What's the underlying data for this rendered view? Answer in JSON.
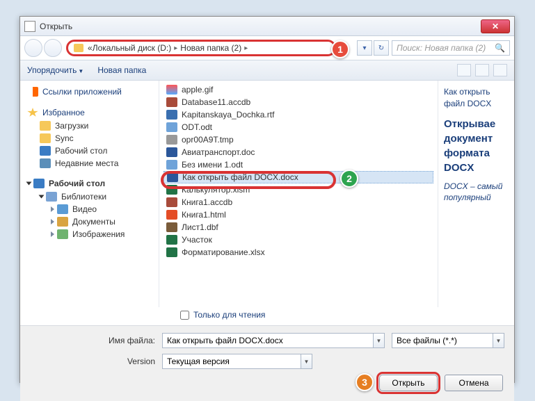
{
  "window": {
    "title": "Открыть"
  },
  "breadcrumb": {
    "prefix": "«",
    "segments": [
      "Локальный диск (D:)",
      "Новая папка (2)"
    ]
  },
  "search": {
    "placeholder": "Поиск: Новая папка (2)"
  },
  "toolbar": {
    "organize": "Упорядочить",
    "newfolder": "Новая папка"
  },
  "sidebar": {
    "appLinks": "Ссылки приложений",
    "favorites": "Избранное",
    "favItems": [
      "Загрузки",
      "Sync",
      "Рабочий стол",
      "Недавние места"
    ],
    "desktop": "Рабочий стол",
    "libraries": "Библиотеки",
    "libItems": [
      "Видео",
      "Документы",
      "Изображения"
    ]
  },
  "files": [
    {
      "name": "apple.gif",
      "ext": "gif"
    },
    {
      "name": "Database11.accdb",
      "ext": "accdb"
    },
    {
      "name": "Kapitanskaya_Dochka.rtf",
      "ext": "rtf"
    },
    {
      "name": "ODT.odt",
      "ext": "odt"
    },
    {
      "name": "opr00A9T.tmp",
      "ext": "tmp"
    },
    {
      "name": "Авиатранспорт.doc",
      "ext": "doc"
    },
    {
      "name": "Без имени 1.odt",
      "ext": "odt"
    },
    {
      "name": "Как открыть файл DOCX.docx",
      "ext": "docx",
      "selected": true
    },
    {
      "name": "Калькулятор.xlsm",
      "ext": "xlsm"
    },
    {
      "name": "Книга1.accdb",
      "ext": "accdb"
    },
    {
      "name": "Книга1.html",
      "ext": "html"
    },
    {
      "name": "Лист1.dbf",
      "ext": "dbf"
    },
    {
      "name": "Участок",
      "ext": "xlsx"
    },
    {
      "name": "Форматирование.xlsx",
      "ext": "xlsx"
    }
  ],
  "preview": {
    "line1": "Как открыть файл DOCX",
    "line2": "Открывае документ формата DOCX",
    "line3": "DOCX – самый популярный"
  },
  "readonly": "Только для чтения",
  "bottom": {
    "filenameLabel": "Имя файла:",
    "filenameValue": "Как открыть файл DOCX.docx",
    "filter": "Все файлы (*.*)",
    "versionLabel": "Version",
    "versionValue": "Текущая версия",
    "open": "Открыть",
    "cancel": "Отмена"
  },
  "callouts": {
    "c1": "1",
    "c2": "2",
    "c3": "3"
  }
}
